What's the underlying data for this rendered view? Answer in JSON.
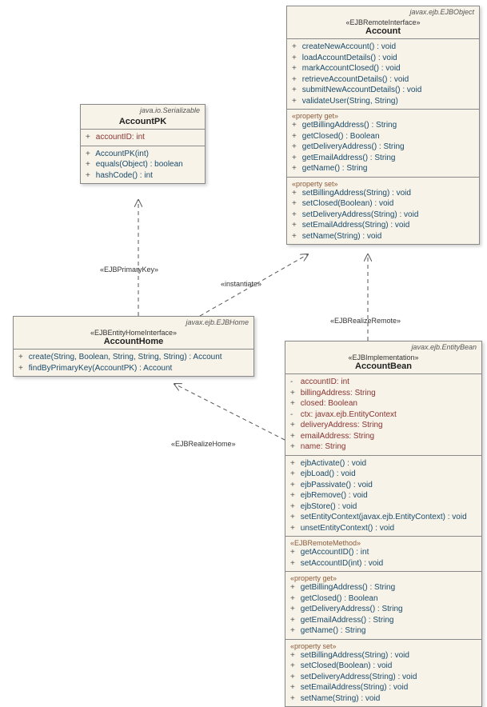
{
  "classes": {
    "accountpk": {
      "extends": "java.io.Serializable",
      "stereotype": "",
      "name": "AccountPK",
      "attrs": [
        {
          "vis": "+",
          "text": "accountID: int",
          "private": true
        }
      ],
      "ops": [
        {
          "vis": "+",
          "text": "AccountPK(int)"
        },
        {
          "vis": "+",
          "text": "equals(Object) : boolean"
        },
        {
          "vis": "+",
          "text": "hashCode() : int"
        }
      ]
    },
    "accounthome": {
      "extends": "javax.ejb.EJBHome",
      "stereotype": "«EJBEntityHomeInterface»",
      "name": "AccountHome",
      "ops": [
        {
          "vis": "+",
          "text": "create(String, Boolean, String, String, String) : Account"
        },
        {
          "vis": "+",
          "text": "findByPrimaryKey(AccountPK) : Account"
        }
      ]
    },
    "account": {
      "extends": "javax.ejb.EJBObject",
      "stereotype": "«EJBRemoteInterface»",
      "name": "Account",
      "ops": [
        {
          "vis": "+",
          "text": "createNewAccount() : void"
        },
        {
          "vis": "+",
          "text": "loadAccountDetails() : void"
        },
        {
          "vis": "+",
          "text": "markAccountClosed() : void"
        },
        {
          "vis": "+",
          "text": "retrieveAccountDetails() : void"
        },
        {
          "vis": "+",
          "text": "submitNewAccountDetails() : void"
        },
        {
          "vis": "+",
          "text": "validateUser(String, String)"
        }
      ],
      "propget": [
        {
          "vis": "+",
          "text": "getBillingAddress() : String"
        },
        {
          "vis": "+",
          "text": "getClosed() : Boolean"
        },
        {
          "vis": "+",
          "text": "getDeliveryAddress() : String"
        },
        {
          "vis": "+",
          "text": "getEmailAddress() : String"
        },
        {
          "vis": "+",
          "text": "getName() : String"
        }
      ],
      "propset": [
        {
          "vis": "+",
          "text": "setBillingAddress(String) : void"
        },
        {
          "vis": "+",
          "text": "setClosed(Boolean) : void"
        },
        {
          "vis": "+",
          "text": "setDeliveryAddress(String) : void"
        },
        {
          "vis": "+",
          "text": "setEmailAddress(String) : void"
        },
        {
          "vis": "+",
          "text": "setName(String) : void"
        }
      ]
    },
    "accountbean": {
      "extends": "javax.ejb.EntityBean",
      "stereotype": "«EJBImplementation»",
      "name": "AccountBean",
      "attrs": [
        {
          "vis": "-",
          "text": "accountID: int",
          "private": true
        },
        {
          "vis": "+",
          "text": "billingAddress: String",
          "private": true
        },
        {
          "vis": "+",
          "text": "closed: Boolean",
          "private": true
        },
        {
          "vis": "-",
          "text": "ctx: javax.ejb.EntityContext",
          "private": true
        },
        {
          "vis": "+",
          "text": "deliveryAddress: String",
          "private": true
        },
        {
          "vis": "+",
          "text": "emailAddress: String",
          "private": true
        },
        {
          "vis": "+",
          "text": "name: String",
          "private": true
        }
      ],
      "ops": [
        {
          "vis": "+",
          "text": "ejbActivate() : void"
        },
        {
          "vis": "+",
          "text": "ejbLoad() : void"
        },
        {
          "vis": "+",
          "text": "ejbPassivate() : void"
        },
        {
          "vis": "+",
          "text": "ejbRemove() : void"
        },
        {
          "vis": "+",
          "text": "ejbStore() : void"
        },
        {
          "vis": "+",
          "text": "setEntityContext(javax.ejb.EntityContext) : void"
        },
        {
          "vis": "+",
          "text": "unsetEntityContext() : void"
        }
      ],
      "remotemethod": [
        {
          "vis": "+",
          "text": "getAccountID() : int"
        },
        {
          "vis": "+",
          "text": "setAccountID(int) : void"
        }
      ],
      "propget": [
        {
          "vis": "+",
          "text": "getBillingAddress() : String"
        },
        {
          "vis": "+",
          "text": "getClosed() : Boolean"
        },
        {
          "vis": "+",
          "text": "getDeliveryAddress() : String"
        },
        {
          "vis": "+",
          "text": "getEmailAddress() : String"
        },
        {
          "vis": "+",
          "text": "getName() : String"
        }
      ],
      "propset": [
        {
          "vis": "+",
          "text": "setBillingAddress(String) : void"
        },
        {
          "vis": "+",
          "text": "setClosed(Boolean) : void"
        },
        {
          "vis": "+",
          "text": "setDeliveryAddress(String) : void"
        },
        {
          "vis": "+",
          "text": "setEmailAddress(String) : void"
        },
        {
          "vis": "+",
          "text": "setName(String) : void"
        }
      ]
    }
  },
  "labels": {
    "ejbprimarykey": "«EJBPrimaryKey»",
    "instantiate": "«instantiate»",
    "ejbrealizeremote": "«EJBRealizeRemote»",
    "ejbrealizehome": "«EJBRealizeHome»",
    "propertyget": "«property get»",
    "propertyset": "«property set»",
    "ejbremotemethod": "«EJBRemoteMethod»"
  }
}
